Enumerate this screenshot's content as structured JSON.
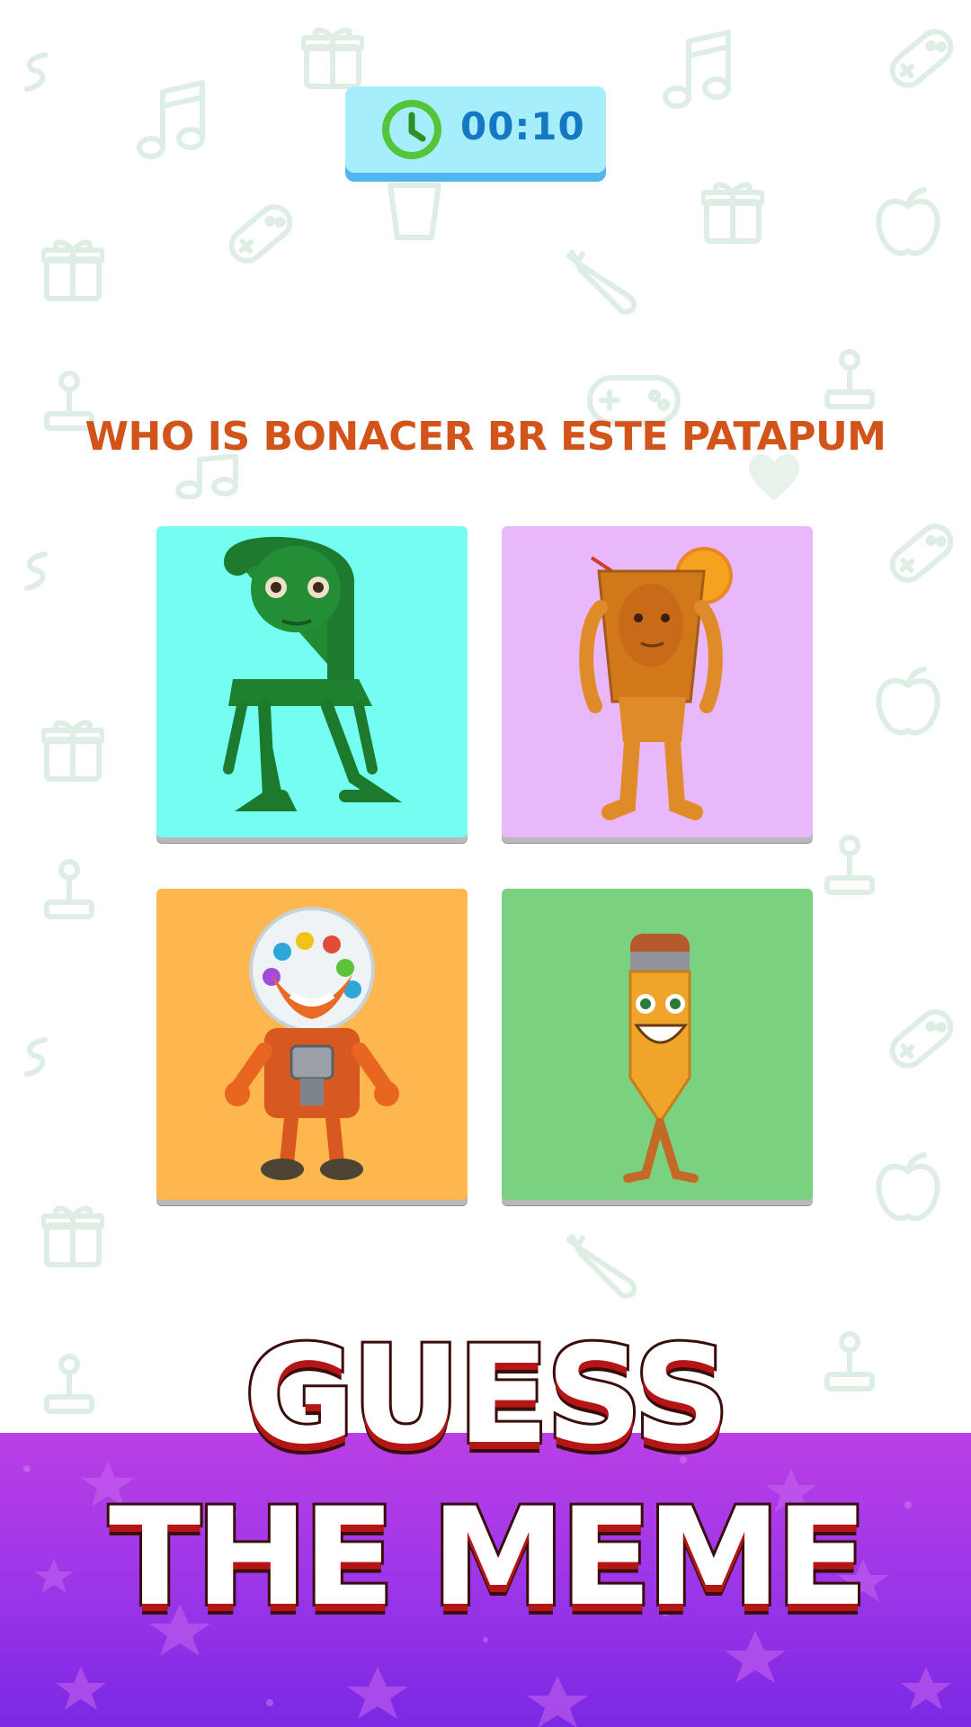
{
  "timer": {
    "value": "00:10",
    "icon": "clock-icon"
  },
  "question": {
    "text": "WHO IS BONACER BR ESTE PATAPUM"
  },
  "answers": [
    {
      "id": "chair",
      "icon": "green-chair-character-icon",
      "bg": "#74fdf1"
    },
    {
      "id": "drink",
      "icon": "iced-tea-character-icon",
      "bg": "#e8b8fb"
    },
    {
      "id": "gumball",
      "icon": "gumball-machine-character-icon",
      "bg": "#feb64e"
    },
    {
      "id": "pencil",
      "icon": "pencil-character-icon",
      "bg": "#7ad280"
    }
  ],
  "title": {
    "line1": "GUESS",
    "line2": "THE MEME"
  },
  "colors": {
    "timer_bg": "#a6eefb",
    "timer_text": "#1478c4",
    "question": "#d2541a",
    "banner_top": "#bb3fe6",
    "banner_bottom": "#7b28e4"
  }
}
